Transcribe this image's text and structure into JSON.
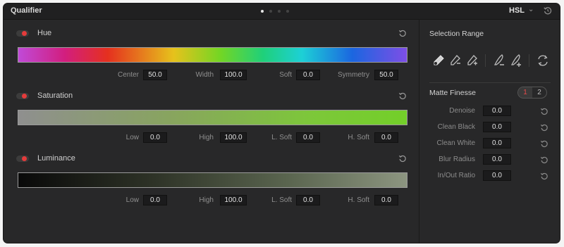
{
  "header": {
    "title": "Qualifier",
    "mode": "HSL",
    "page_dots": 4,
    "active_dot": 0
  },
  "hue": {
    "label": "Hue",
    "params": [
      {
        "label": "Center",
        "value": "50.0"
      },
      {
        "label": "Width",
        "value": "100.0"
      },
      {
        "label": "Soft",
        "value": "0.0"
      },
      {
        "label": "Symmetry",
        "value": "50.0"
      }
    ]
  },
  "saturation": {
    "label": "Saturation",
    "params": [
      {
        "label": "Low",
        "value": "0.0"
      },
      {
        "label": "High",
        "value": "100.0"
      },
      {
        "label": "L. Soft",
        "value": "0.0"
      },
      {
        "label": "H. Soft",
        "value": "0.0"
      }
    ]
  },
  "luminance": {
    "label": "Luminance",
    "params": [
      {
        "label": "Low",
        "value": "0.0"
      },
      {
        "label": "High",
        "value": "100.0"
      },
      {
        "label": "L. Soft",
        "value": "0.0"
      },
      {
        "label": "H. Soft",
        "value": "0.0"
      }
    ]
  },
  "selection_range": {
    "title": "Selection Range",
    "tools": [
      "picker-icon",
      "picker-subtract-icon",
      "picker-add-icon",
      "feather-subtract-icon",
      "feather-add-icon",
      "invert-icon"
    ]
  },
  "matte_finesse": {
    "title": "Matte Finesse",
    "pages": [
      "1",
      "2"
    ],
    "active_page": "1",
    "rows": [
      {
        "label": "Denoise",
        "value": "0.0"
      },
      {
        "label": "Clean Black",
        "value": "0.0"
      },
      {
        "label": "Clean White",
        "value": "0.0"
      },
      {
        "label": "Blur Radius",
        "value": "0.0"
      },
      {
        "label": "In/Out Ratio",
        "value": "0.0"
      }
    ]
  },
  "colors": {
    "panel": "#282829",
    "toggle_on": "#e53b3b",
    "accent_page": "#e84a4a"
  }
}
